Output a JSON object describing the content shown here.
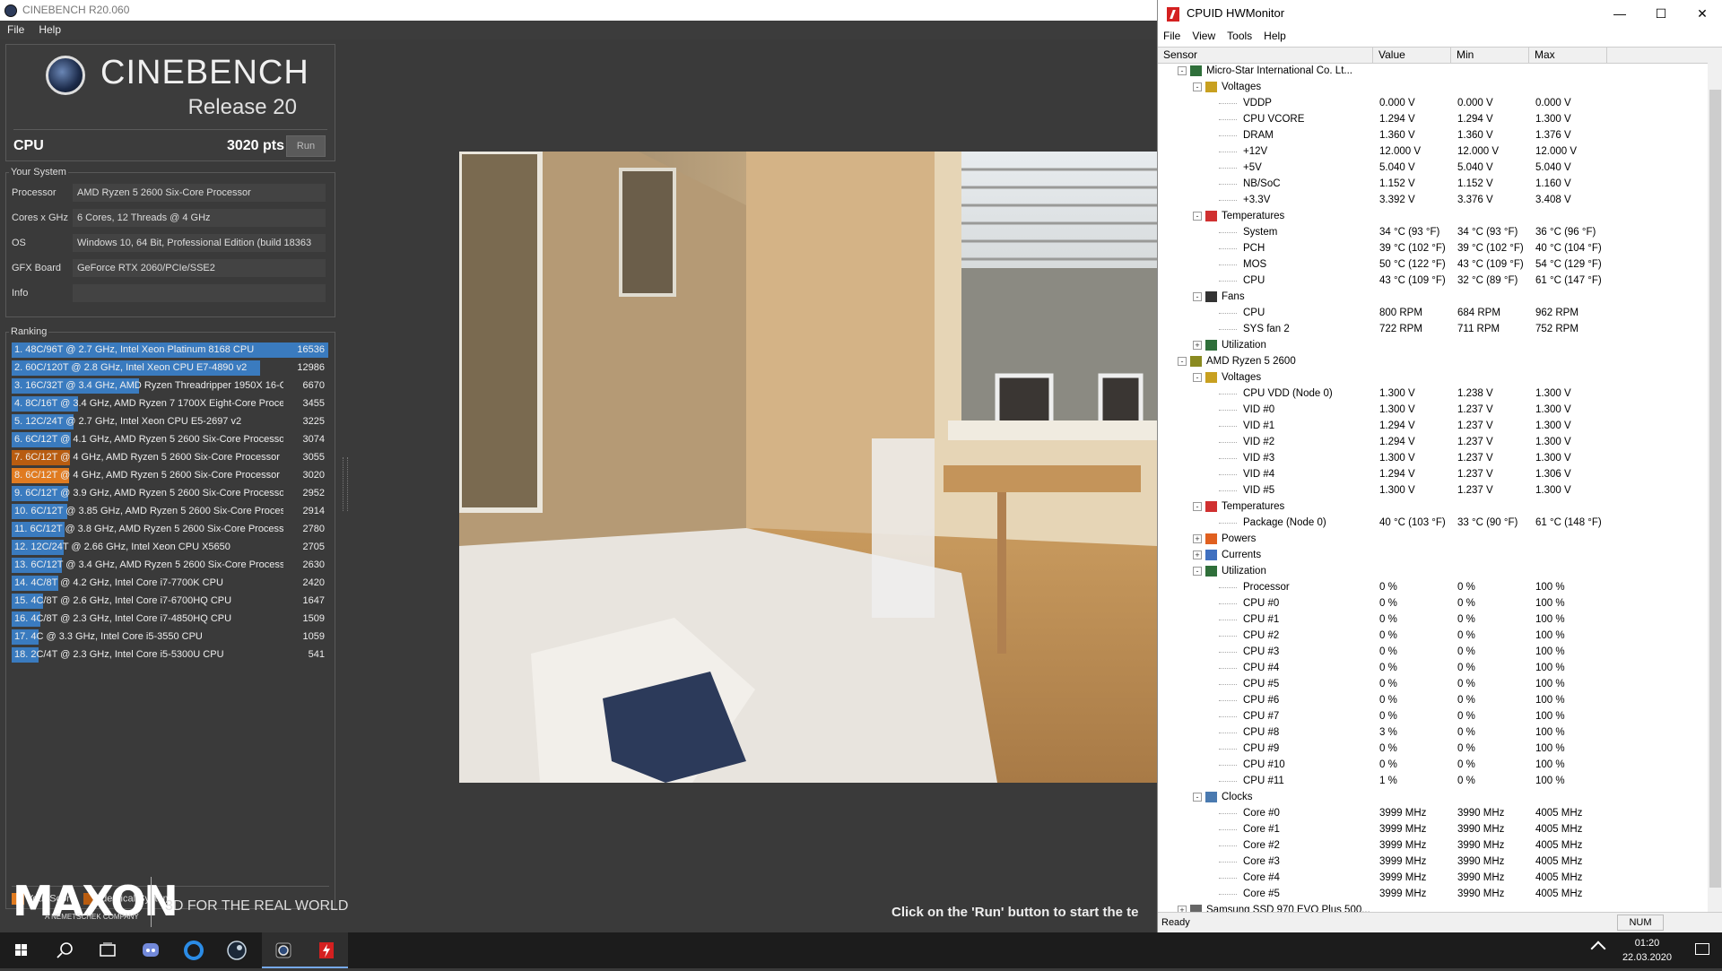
{
  "cinebench": {
    "title": "CINEBENCH R20.060",
    "menu": [
      "File",
      "Help"
    ],
    "brand": "CINEBENCH",
    "release": "Release 20",
    "cpu_label": "CPU",
    "cpu_score": "3020 pts",
    "run_label": "Run",
    "your_system": {
      "title": "Your System",
      "rows": [
        {
          "label": "Processor",
          "value": "AMD Ryzen 5 2600 Six-Core Processor"
        },
        {
          "label": "Cores x GHz",
          "value": "6 Cores, 12 Threads @ 4 GHz"
        },
        {
          "label": "OS",
          "value": "Windows 10, 64 Bit, Professional Edition (build 18363"
        },
        {
          "label": "GFX Board",
          "value": "GeForce RTX 2060/PCIe/SSE2"
        },
        {
          "label": "Info",
          "value": ""
        }
      ]
    },
    "ranking": {
      "title": "Ranking",
      "max_score": 16536,
      "rows": [
        {
          "text": "1. 48C/96T @ 2.7 GHz, Intel Xeon Platinum 8168 CPU",
          "score": 16536,
          "kind": "ref"
        },
        {
          "text": "2. 60C/120T @ 2.8 GHz, Intel Xeon CPU E7-4890 v2",
          "score": 12986,
          "kind": "ref"
        },
        {
          "text": "3. 16C/32T @ 3.4 GHz, AMD Ryzen Threadripper 1950X 16-C",
          "score": 6670,
          "kind": "ref"
        },
        {
          "text": "4. 8C/16T @ 3.4 GHz, AMD Ryzen 7 1700X Eight-Core Proce:",
          "score": 3455,
          "kind": "ref"
        },
        {
          "text": "5. 12C/24T @ 2.7 GHz, Intel Xeon CPU E5-2697 v2",
          "score": 3225,
          "kind": "ref"
        },
        {
          "text": "6. 6C/12T @ 4.1 GHz, AMD Ryzen 5 2600 Six-Core Processor",
          "score": 3074,
          "kind": "ref"
        },
        {
          "text": "7. 6C/12T @ 4 GHz, AMD Ryzen 5 2600 Six-Core Processor",
          "score": 3055,
          "kind": "identical"
        },
        {
          "text": "8. 6C/12T @ 4 GHz, AMD Ryzen 5 2600 Six-Core Processor",
          "score": 3020,
          "kind": "yours"
        },
        {
          "text": "9. 6C/12T @ 3.9 GHz, AMD Ryzen 5 2600 Six-Core Processor",
          "score": 2952,
          "kind": "ref"
        },
        {
          "text": "10. 6C/12T @ 3.85 GHz, AMD Ryzen 5 2600 Six-Core Process",
          "score": 2914,
          "kind": "ref"
        },
        {
          "text": "11. 6C/12T @ 3.8 GHz, AMD Ryzen 5 2600 Six-Core Processc",
          "score": 2780,
          "kind": "ref"
        },
        {
          "text": "12. 12C/24T @ 2.66 GHz, Intel Xeon CPU X5650",
          "score": 2705,
          "kind": "ref"
        },
        {
          "text": "13. 6C/12T @ 3.4 GHz, AMD Ryzen 5 2600 Six-Core Processc",
          "score": 2630,
          "kind": "ref"
        },
        {
          "text": "14. 4C/8T @ 4.2 GHz, Intel Core i7-7700K CPU",
          "score": 2420,
          "kind": "ref"
        },
        {
          "text": "15. 4C/8T @ 2.6 GHz, Intel Core i7-6700HQ CPU",
          "score": 1647,
          "kind": "ref"
        },
        {
          "text": "16. 4C/8T @ 2.3 GHz, Intel Core i7-4850HQ CPU",
          "score": 1509,
          "kind": "ref"
        },
        {
          "text": "17. 4C @ 3.3 GHz, Intel Core i5-3550 CPU",
          "score": 1059,
          "kind": "ref"
        },
        {
          "text": "18. 2C/4T @ 2.3 GHz, Intel Core i5-5300U CPU",
          "score": 541,
          "kind": "ref"
        }
      ]
    },
    "legend": {
      "your_score": "Your Score",
      "identical": "Identical System"
    },
    "maxon": {
      "logo": "MAXON",
      "sub": "A NEMETSCHEK COMPANY",
      "tagline": "3D FOR THE REAL WORLD"
    },
    "hint": "Click on the 'Run' button to start the te",
    "colors": {
      "ref": "#3a7bbf",
      "yours": "#e07b20",
      "identical": "#b85c10"
    }
  },
  "hwmonitor": {
    "title": "CPUID HWMonitor",
    "menu": [
      "File",
      "View",
      "Tools",
      "Help"
    ],
    "columns": [
      "Sensor",
      "Value",
      "Min",
      "Max"
    ],
    "rows": [
      {
        "level": 0,
        "icon": "motherboard-icon",
        "exp": "-",
        "name": "Micro-Star International Co. Lt..."
      },
      {
        "level": 1,
        "icon": "voltage-icon",
        "exp": "-",
        "name": "Voltages"
      },
      {
        "level": 2,
        "name": "VDDP",
        "value": "0.000 V",
        "min": "0.000 V",
        "max": "0.000 V"
      },
      {
        "level": 2,
        "name": "CPU VCORE",
        "value": "1.294 V",
        "min": "1.294 V",
        "max": "1.300 V"
      },
      {
        "level": 2,
        "name": "DRAM",
        "value": "1.360 V",
        "min": "1.360 V",
        "max": "1.376 V"
      },
      {
        "level": 2,
        "name": "+12V",
        "value": "12.000 V",
        "min": "12.000 V",
        "max": "12.000 V"
      },
      {
        "level": 2,
        "name": "+5V",
        "value": "5.040 V",
        "min": "5.040 V",
        "max": "5.040 V"
      },
      {
        "level": 2,
        "name": "NB/SoC",
        "value": "1.152 V",
        "min": "1.152 V",
        "max": "1.160 V"
      },
      {
        "level": 2,
        "name": "+3.3V",
        "value": "3.392 V",
        "min": "3.376 V",
        "max": "3.408 V"
      },
      {
        "level": 1,
        "icon": "thermometer-icon",
        "exp": "-",
        "name": "Temperatures"
      },
      {
        "level": 2,
        "name": "System",
        "value": "34 °C (93 °F)",
        "min": "34 °C (93 °F)",
        "max": "36 °C (96 °F)"
      },
      {
        "level": 2,
        "name": "PCH",
        "value": "39 °C (102 °F)",
        "min": "39 °C (102 °F)",
        "max": "40 °C (104 °F)"
      },
      {
        "level": 2,
        "name": "MOS",
        "value": "50 °C (122 °F)",
        "min": "43 °C (109 °F)",
        "max": "54 °C (129 °F)"
      },
      {
        "level": 2,
        "name": "CPU",
        "value": "43 °C (109 °F)",
        "min": "32 °C (89 °F)",
        "max": "61 °C (147 °F)"
      },
      {
        "level": 1,
        "icon": "fan-icon",
        "exp": "-",
        "name": "Fans"
      },
      {
        "level": 2,
        "name": "CPU",
        "value": "800 RPM",
        "min": "684 RPM",
        "max": "962 RPM"
      },
      {
        "level": 2,
        "name": "SYS fan 2",
        "value": "722 RPM",
        "min": "711 RPM",
        "max": "752 RPM"
      },
      {
        "level": 1,
        "icon": "utilization-icon",
        "exp": "+",
        "name": "Utilization"
      },
      {
        "level": 0,
        "icon": "cpu-chip-icon",
        "exp": "-",
        "name": "AMD Ryzen 5 2600"
      },
      {
        "level": 1,
        "icon": "voltage-icon",
        "exp": "-",
        "name": "Voltages"
      },
      {
        "level": 2,
        "name": "CPU VDD (Node 0)",
        "value": "1.300 V",
        "min": "1.238 V",
        "max": "1.300 V"
      },
      {
        "level": 2,
        "name": "VID #0",
        "value": "1.300 V",
        "min": "1.237 V",
        "max": "1.300 V"
      },
      {
        "level": 2,
        "name": "VID #1",
        "value": "1.294 V",
        "min": "1.237 V",
        "max": "1.300 V"
      },
      {
        "level": 2,
        "name": "VID #2",
        "value": "1.294 V",
        "min": "1.237 V",
        "max": "1.300 V"
      },
      {
        "level": 2,
        "name": "VID #3",
        "value": "1.300 V",
        "min": "1.237 V",
        "max": "1.300 V"
      },
      {
        "level": 2,
        "name": "VID #4",
        "value": "1.294 V",
        "min": "1.237 V",
        "max": "1.306 V"
      },
      {
        "level": 2,
        "name": "VID #5",
        "value": "1.300 V",
        "min": "1.237 V",
        "max": "1.300 V"
      },
      {
        "level": 1,
        "icon": "thermometer-icon",
        "exp": "-",
        "name": "Temperatures"
      },
      {
        "level": 2,
        "name": "Package (Node 0)",
        "value": "40 °C (103 °F)",
        "min": "33 °C (90 °F)",
        "max": "61 °C (148 °F)"
      },
      {
        "level": 1,
        "icon": "power-icon",
        "exp": "+",
        "name": "Powers"
      },
      {
        "level": 1,
        "icon": "current-icon",
        "exp": "+",
        "name": "Currents"
      },
      {
        "level": 1,
        "icon": "utilization-icon",
        "exp": "-",
        "name": "Utilization"
      },
      {
        "level": 2,
        "name": "Processor",
        "value": "0 %",
        "min": "0 %",
        "max": "100 %"
      },
      {
        "level": 2,
        "name": "CPU #0",
        "value": "0 %",
        "min": "0 %",
        "max": "100 %"
      },
      {
        "level": 2,
        "name": "CPU #1",
        "value": "0 %",
        "min": "0 %",
        "max": "100 %"
      },
      {
        "level": 2,
        "name": "CPU #2",
        "value": "0 %",
        "min": "0 %",
        "max": "100 %"
      },
      {
        "level": 2,
        "name": "CPU #3",
        "value": "0 %",
        "min": "0 %",
        "max": "100 %"
      },
      {
        "level": 2,
        "name": "CPU #4",
        "value": "0 %",
        "min": "0 %",
        "max": "100 %"
      },
      {
        "level": 2,
        "name": "CPU #5",
        "value": "0 %",
        "min": "0 %",
        "max": "100 %"
      },
      {
        "level": 2,
        "name": "CPU #6",
        "value": "0 %",
        "min": "0 %",
        "max": "100 %"
      },
      {
        "level": 2,
        "name": "CPU #7",
        "value": "0 %",
        "min": "0 %",
        "max": "100 %"
      },
      {
        "level": 2,
        "name": "CPU #8",
        "value": "3 %",
        "min": "0 %",
        "max": "100 %"
      },
      {
        "level": 2,
        "name": "CPU #9",
        "value": "0 %",
        "min": "0 %",
        "max": "100 %"
      },
      {
        "level": 2,
        "name": "CPU #10",
        "value": "0 %",
        "min": "0 %",
        "max": "100 %"
      },
      {
        "level": 2,
        "name": "CPU #11",
        "value": "1 %",
        "min": "0 %",
        "max": "100 %"
      },
      {
        "level": 1,
        "icon": "clock-icon",
        "exp": "-",
        "name": "Clocks"
      },
      {
        "level": 2,
        "name": "Core #0",
        "value": "3999 MHz",
        "min": "3990 MHz",
        "max": "4005 MHz"
      },
      {
        "level": 2,
        "name": "Core #1",
        "value": "3999 MHz",
        "min": "3990 MHz",
        "max": "4005 MHz"
      },
      {
        "level": 2,
        "name": "Core #2",
        "value": "3999 MHz",
        "min": "3990 MHz",
        "max": "4005 MHz"
      },
      {
        "level": 2,
        "name": "Core #3",
        "value": "3999 MHz",
        "min": "3990 MHz",
        "max": "4005 MHz"
      },
      {
        "level": 2,
        "name": "Core #4",
        "value": "3999 MHz",
        "min": "3990 MHz",
        "max": "4005 MHz"
      },
      {
        "level": 2,
        "name": "Core #5",
        "value": "3999 MHz",
        "min": "3990 MHz",
        "max": "4005 MHz"
      },
      {
        "level": 0,
        "icon": "drive-icon",
        "exp": "+",
        "name": "Samsung SSD 970 EVO Plus 500..."
      }
    ],
    "status": "Ready",
    "num": "NUM"
  },
  "taskbar": {
    "apps": [
      "start-icon",
      "search-icon",
      "task-view-icon",
      "discord-icon",
      "edge-icon",
      "steam-icon",
      "cinebench-icon",
      "hwmonitor-icon"
    ],
    "time": "01:20",
    "date": "22.03.2020"
  }
}
